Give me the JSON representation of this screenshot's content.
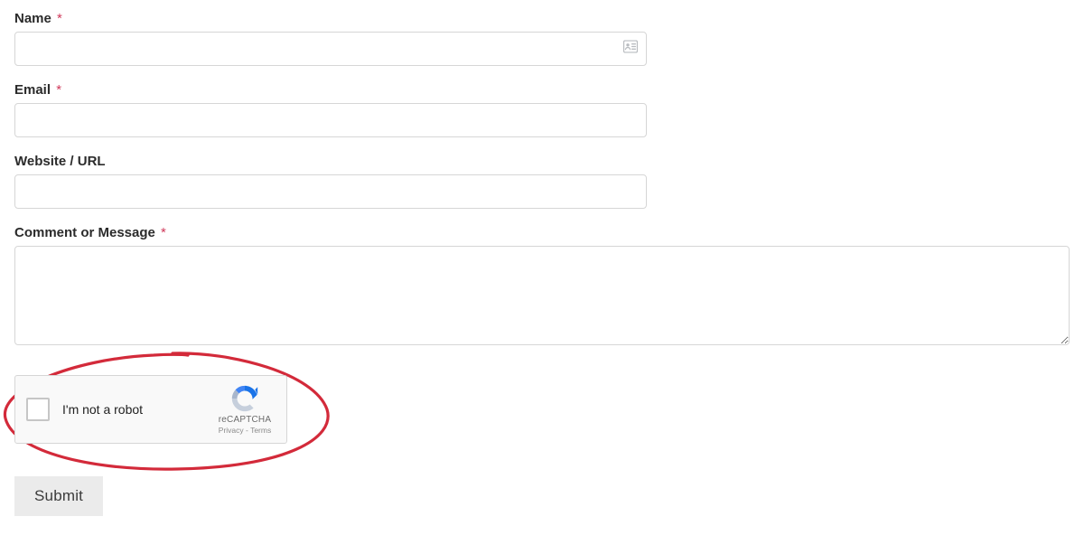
{
  "form": {
    "name": {
      "label": "Name",
      "required": true,
      "value": ""
    },
    "email": {
      "label": "Email",
      "required": true,
      "value": ""
    },
    "website": {
      "label": "Website / URL",
      "required": false,
      "value": ""
    },
    "comment": {
      "label": "Comment or Message",
      "required": true,
      "value": ""
    }
  },
  "required_mark": "*",
  "recaptcha": {
    "label": "I'm not a robot",
    "brand": "reCAPTCHA",
    "privacy": "Privacy",
    "terms": "Terms",
    "separator": " - "
  },
  "submit_label": "Submit"
}
